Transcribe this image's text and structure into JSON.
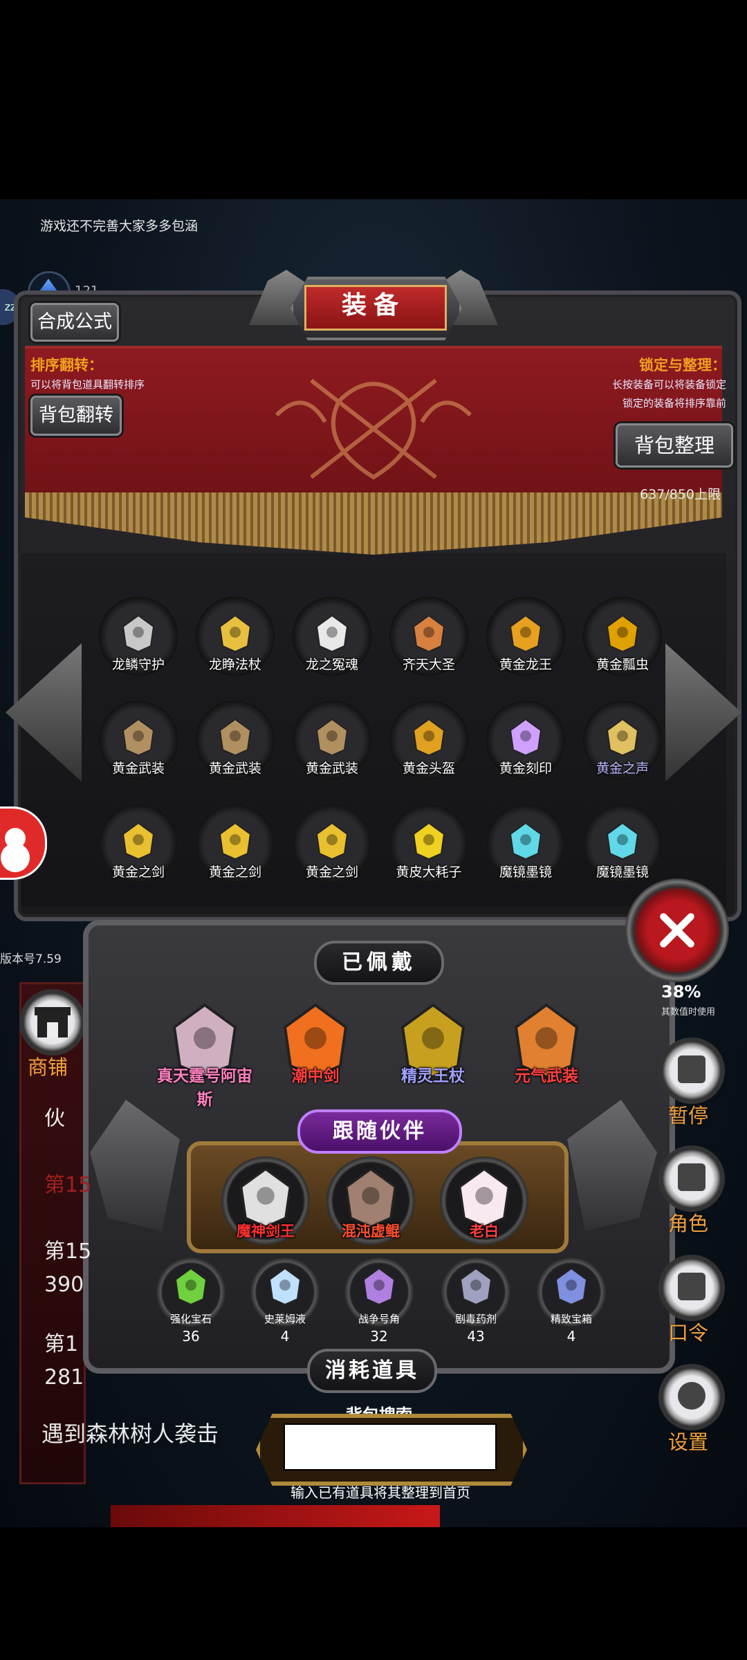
{
  "notice": "游戏还不完善大家多多包涵",
  "gem_count": "121",
  "side_tab_left": "zz",
  "header": {
    "title": "装备",
    "recipe_button": "合成公式",
    "flip_hint_title": "排序翻转：",
    "flip_hint_text": "可以将背包道具翻转排序",
    "flip_button": "背包翻转",
    "lock_hint_title": "锁定与整理：",
    "lock_hint_text1": "长按装备可以将装备锁定",
    "lock_hint_text2": "锁定的装备将排序靠前",
    "sort_button": "背包整理",
    "capacity": "637/850上限"
  },
  "inventory": [
    {
      "label": "龙鳞守护",
      "icon": "dragon-mask-icon",
      "color": "#c8c8c8"
    },
    {
      "label": "龙睁法杖",
      "icon": "golden-staff-icon",
      "color": "#e8c040"
    },
    {
      "label": "龙之冤魂",
      "icon": "skeleton-dragon-icon",
      "color": "#e8e8e8"
    },
    {
      "label": "齐天大圣",
      "icon": "monkey-king-icon",
      "color": "#d88040"
    },
    {
      "label": "黄金龙王",
      "icon": "golden-dragon-icon",
      "color": "#e8a020"
    },
    {
      "label": "黄金瓢虫",
      "icon": "golden-beetle-icon",
      "color": "#e0a000"
    },
    {
      "label": "黄金武装",
      "icon": "golden-armor-icon",
      "color": "#b09060"
    },
    {
      "label": "黄金武装",
      "icon": "golden-armor-icon",
      "color": "#b09060"
    },
    {
      "label": "黄金武装",
      "icon": "golden-armor-icon",
      "color": "#b09060"
    },
    {
      "label": "黄金头盔",
      "icon": "golden-helmet-icon",
      "color": "#e0a020"
    },
    {
      "label": "黄金刻印",
      "icon": "golden-seal-icon",
      "color": "#d0a0ff"
    },
    {
      "label": "黄金之声",
      "icon": "golden-harp-icon",
      "color": "#e0c060",
      "label_color": "#b8b8ff"
    },
    {
      "label": "黄金之剑",
      "icon": "golden-sword-icon",
      "color": "#e8c030"
    },
    {
      "label": "黄金之剑",
      "icon": "golden-sword-icon",
      "color": "#e8c030"
    },
    {
      "label": "黄金之剑",
      "icon": "golden-sword-icon",
      "color": "#e8c030"
    },
    {
      "label": "黄皮大耗子",
      "icon": "yellow-rat-icon",
      "color": "#f0d020"
    },
    {
      "label": "魔镜墨镜",
      "icon": "magic-mirror-icon",
      "color": "#60d8e8"
    },
    {
      "label": "魔镜墨镜",
      "icon": "magic-mirror-icon",
      "color": "#60d8e8"
    }
  ],
  "left_panel": {
    "version": "版本号7.59",
    "shop": "商铺",
    "log_lines": [
      "伙",
      "第15",
      "第15",
      "390",
      "第1",
      "281"
    ],
    "log_bottom": "遇到森林树人袭击"
  },
  "equipped": {
    "title": "已佩戴",
    "items": [
      {
        "label": "真天霆号阿宙斯",
        "icon": "armored-angel-icon",
        "color": "#d0b0c0",
        "label_color": "#ff80c0"
      },
      {
        "label": "潮中剑",
        "icon": "flame-sword-icon",
        "color": "#f07020",
        "label_color": "#ff4040"
      },
      {
        "label": "精灵王杖",
        "icon": "elf-scepter-icon",
        "color": "#c8a020",
        "label_color": "#a0a0ff"
      },
      {
        "label": "元气武装",
        "icon": "energy-armor-icon",
        "color": "#e08030",
        "label_color": "#ff4040"
      }
    ]
  },
  "partner": {
    "title": "跟随伙伴",
    "items": [
      {
        "label": "魔神剑王",
        "icon": "demon-sword-king-icon",
        "color": "#e0e0e0",
        "label_color": "#ff3030"
      },
      {
        "label": "混沌虚鲲",
        "icon": "chaos-whale-icon",
        "color": "#a08070",
        "label_color": "#ff5030"
      },
      {
        "label": "老白",
        "icon": "white-dolphin-icon",
        "color": "#f8e8f0",
        "label_color": "#ff4040"
      }
    ]
  },
  "consumables": {
    "title": "消耗道具",
    "items": [
      {
        "label": "强化宝石",
        "count": "36",
        "icon": "green-gem-icon",
        "color": "#70d040"
      },
      {
        "label": "史莱姆液",
        "count": "4",
        "icon": "slime-potion-icon",
        "color": "#c0e0ff"
      },
      {
        "label": "战争号角",
        "count": "32",
        "icon": "war-horn-icon",
        "color": "#b080e0"
      },
      {
        "label": "剧毒药剂",
        "count": "43",
        "icon": "poison-flask-icon",
        "color": "#a0a0c0"
      },
      {
        "label": "精致宝箱",
        "count": "4",
        "icon": "treasure-chest-icon",
        "color": "#8090e0"
      }
    ]
  },
  "right_panel": {
    "percent": "38%",
    "percent_sub": "其数值时使用",
    "buttons": [
      {
        "label": "暂停",
        "icon": "dice-icon"
      },
      {
        "label": "角色",
        "icon": "hooded-figure-icon"
      },
      {
        "label": "口令",
        "icon": "book-icon"
      },
      {
        "label": "设置",
        "icon": "gear-icon"
      }
    ]
  },
  "search": {
    "title": "背包搜索",
    "value": "",
    "hint": "输入已有道具将其整理到首页"
  }
}
